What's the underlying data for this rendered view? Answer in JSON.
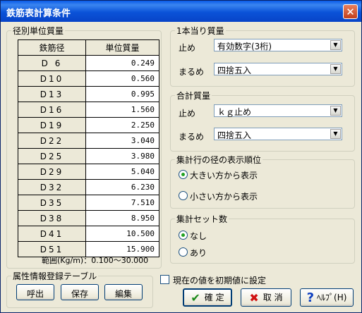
{
  "window": {
    "title": "鉄筋表計算条件",
    "close_glyph": "✕"
  },
  "diameter_group": {
    "legend": "径別単位質量",
    "headers": {
      "diameter": "鉄筋径",
      "unit_mass": "単位質量"
    },
    "rows": [
      {
        "d": "D 6",
        "m": "0.249"
      },
      {
        "d": "D10",
        "m": "0.560"
      },
      {
        "d": "D13",
        "m": "0.995"
      },
      {
        "d": "D16",
        "m": "1.560"
      },
      {
        "d": "D19",
        "m": "2.250"
      },
      {
        "d": "D22",
        "m": "3.040"
      },
      {
        "d": "D25",
        "m": "3.980"
      },
      {
        "d": "D29",
        "m": "5.040"
      },
      {
        "d": "D32",
        "m": "6.230"
      },
      {
        "d": "D35",
        "m": "7.510"
      },
      {
        "d": "D38",
        "m": "8.950"
      },
      {
        "d": "D41",
        "m": "10.500"
      },
      {
        "d": "D51",
        "m": "15.900"
      }
    ],
    "range_text": "範囲(Kg/m)：0.100～30.000"
  },
  "per_piece": {
    "legend": "1本当り質量",
    "stop_label": "止め",
    "stop_value": "有効数字(3桁)",
    "round_label": "まるめ",
    "round_value": "四捨五入"
  },
  "total": {
    "legend": "合計質量",
    "stop_label": "止め",
    "stop_value": "ｋｇ止め",
    "round_label": "まるめ",
    "round_value": "四捨五入"
  },
  "order": {
    "legend": "集計行の径の表示順位",
    "option1": "大きい方から表示",
    "option2": "小さい方から表示",
    "selected": 1
  },
  "set_count": {
    "legend": "集計セット数",
    "option1": "なし",
    "option2": "あり",
    "selected": 1
  },
  "attr_table": {
    "legend": "属性情報登録テーブル",
    "call_label": "呼出",
    "save_label": "保存",
    "edit_label": "編集"
  },
  "default_checkbox_label": "現在の値を初期値に設定",
  "buttons": {
    "ok_label": "確 定",
    "cancel_label": "取 消",
    "help_label": "ﾍﾙﾌﾟ(H)"
  },
  "colors": {
    "title_bar": "#0a52d8",
    "ok_icon": "#1a8a1a",
    "cancel_icon": "#d01010",
    "help_icon": "#1040c0"
  }
}
